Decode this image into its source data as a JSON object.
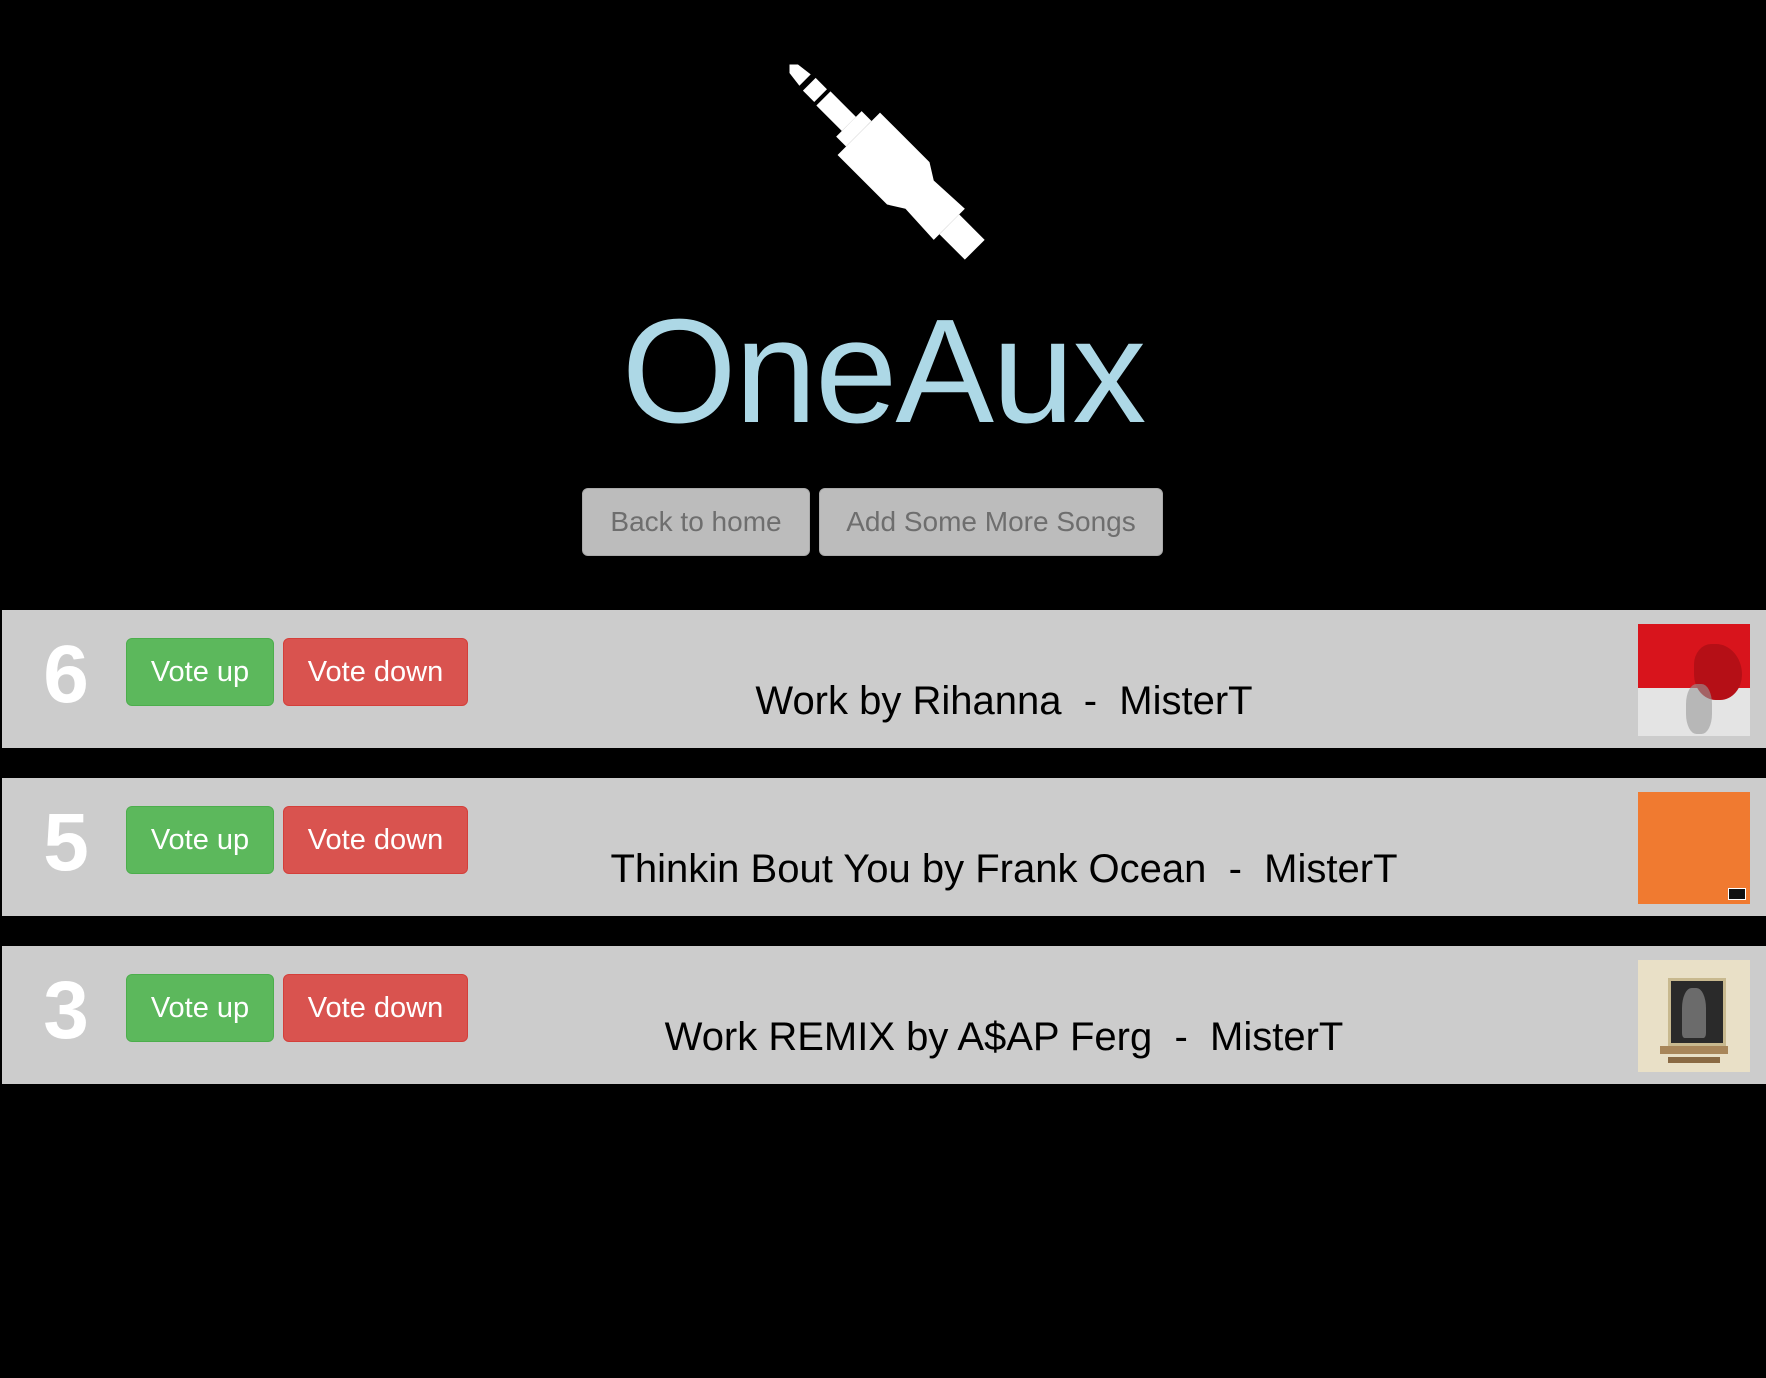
{
  "app": {
    "title": "OneAux",
    "title_color": "#add8e6"
  },
  "nav": {
    "back_label": "Back to home",
    "add_label": "Add Some More Songs"
  },
  "colors": {
    "background": "#000000",
    "row_background": "#cccccc",
    "vote_up": "#5cb85c",
    "vote_down": "#d9534f",
    "nav_button": "#bcbcbc"
  },
  "songs": [
    {
      "votes": "6",
      "vote_up_label": "Vote up",
      "vote_down_label": "Vote down",
      "title": "Work by Rihanna  -  MisterT",
      "album_art": "anti-album-cover"
    },
    {
      "votes": "5",
      "vote_up_label": "Vote up",
      "vote_down_label": "Vote down",
      "title": "Thinkin Bout You by Frank Ocean  -  MisterT",
      "album_art": "channel-orange-album-cover"
    },
    {
      "votes": "3",
      "vote_up_label": "Vote up",
      "vote_down_label": "Vote down",
      "title": "Work REMIX by A$AP Ferg  -  MisterT",
      "album_art": "trap-lord-album-cover"
    }
  ],
  "icons": {
    "logo": "audio-jack-icon"
  }
}
